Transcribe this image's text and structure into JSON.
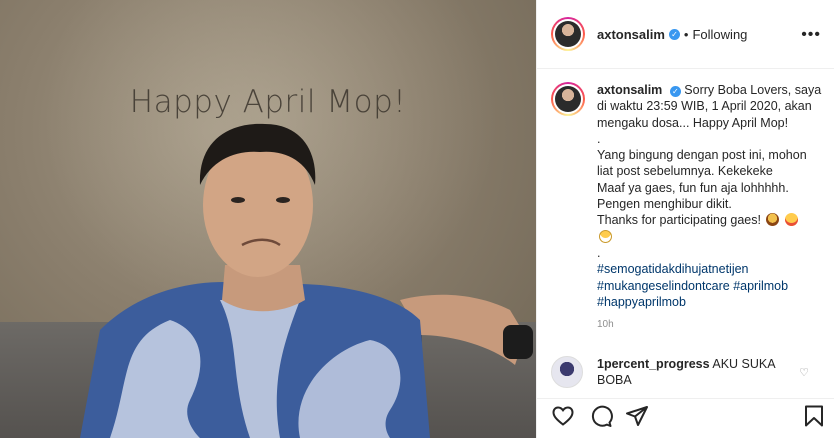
{
  "photo": {
    "overlay_text": "Happy April Mop!"
  },
  "header": {
    "username": "axtonsalim",
    "separator": "•",
    "follow_status": "Following",
    "more_label": "•••"
  },
  "caption": {
    "username": "axtonsalim",
    "lines": [
      "Sorry Boba Lovers, saya di waktu 23:59 WIB, 1 April 2020, akan mengaku dosa... Happy April Mop!",
      ".",
      "Yang bingung dengan post ini, mohon liat post sebelumnya. Kekekeke",
      "Maaf ya gaes, fun fun aja lohhhhh.",
      "Pengen menghibur dikit.",
      "Thanks for participating gaes!",
      "."
    ],
    "hashtags": [
      "#semogatidakdihujatnetijen",
      "#mukangeselindontcare #aprilmob",
      "#happyaprilmob"
    ],
    "time_ago": "10h"
  },
  "comment": {
    "username": "1percent_progress",
    "text": "AKU SUKA BOBA"
  },
  "icons": {
    "like": "heart-icon",
    "comment": "comment-icon",
    "share": "share-icon",
    "save": "bookmark-icon",
    "verified": "verified-badge-icon"
  },
  "colors": {
    "link": "#00376b",
    "verified": "#3897f0",
    "muted": "#8e8e8e"
  }
}
